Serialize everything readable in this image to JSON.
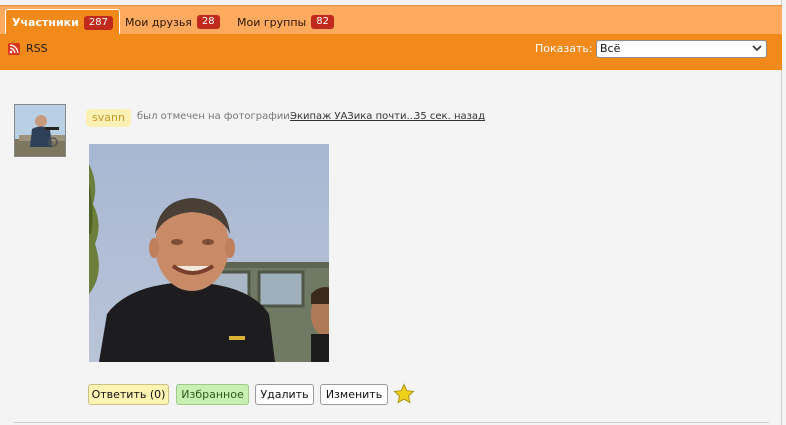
{
  "tabs": [
    {
      "label": "Участники",
      "count": "287"
    },
    {
      "label": "Мои друзья",
      "count": "28"
    },
    {
      "label": "Мои группы",
      "count": "82"
    }
  ],
  "subbar": {
    "rss_label": "RSS",
    "show_label": "Показать:",
    "show_value": "Всё"
  },
  "item": {
    "user": "svann",
    "action": "был отмечен на фотографии:",
    "photo_title": "Экипаж УАЗика почти...",
    "time": "35 сек. назад"
  },
  "buttons": {
    "reply": "Ответить (0)",
    "favorite": "Избранное",
    "delete": "Удалить",
    "edit": "Изменить"
  },
  "icons": {
    "rss": "rss-icon",
    "star": "star-icon",
    "chevron": "chevron-down-icon"
  },
  "colors": {
    "tab_active": "#f1891b",
    "tab_bar": "#ffaa5f",
    "badge": "#c1291c",
    "subbar": "#f1891b"
  }
}
